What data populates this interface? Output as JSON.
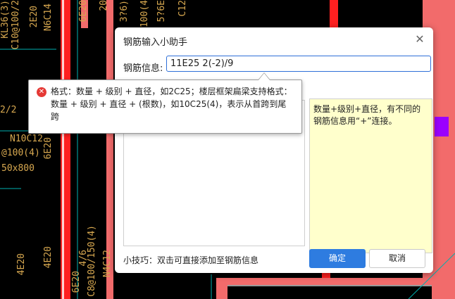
{
  "background": {
    "cad_texts": [
      "KL36(3)",
      "C10@100/2",
      "2E20",
      "N6C14",
      "6E20",
      "20",
      "3?6)",
      "@100(4",
      "5?6E",
      "C12",
      "N10C12",
      "@100(4)",
      "50x800",
      "6E20",
      "4E20",
      "4/6",
      "6E20",
      "C8@100/150(4)",
      "N4C12",
      "2/2",
      "4E20"
    ],
    "colors": {
      "red": "#ff2020",
      "salmon": "#f26b6b",
      "cyan": "#00b0b0",
      "purple": "#9b00ff",
      "text": "#d7a850"
    }
  },
  "dialog": {
    "title": "钢筋输入小助手",
    "close_icon": "close-icon",
    "field_label": "钢筋信息:",
    "field_value": "11E25 2(-2)/9",
    "hint_text": "数量+级别+直径，有不同的钢筋信息用“+”连接。",
    "tip": "小技巧：双击可直接添加至钢筋信息",
    "ok_label": "确定",
    "cancel_label": "取消"
  },
  "tooltip": {
    "icon": "error-icon",
    "text": "格式：数量 + 级别 + 直径，如2C25；楼层框架扁梁支持格式：数量 + 级别 + 直径 + (根数)，如10C25(4)，表示从首跨到尾跨"
  }
}
